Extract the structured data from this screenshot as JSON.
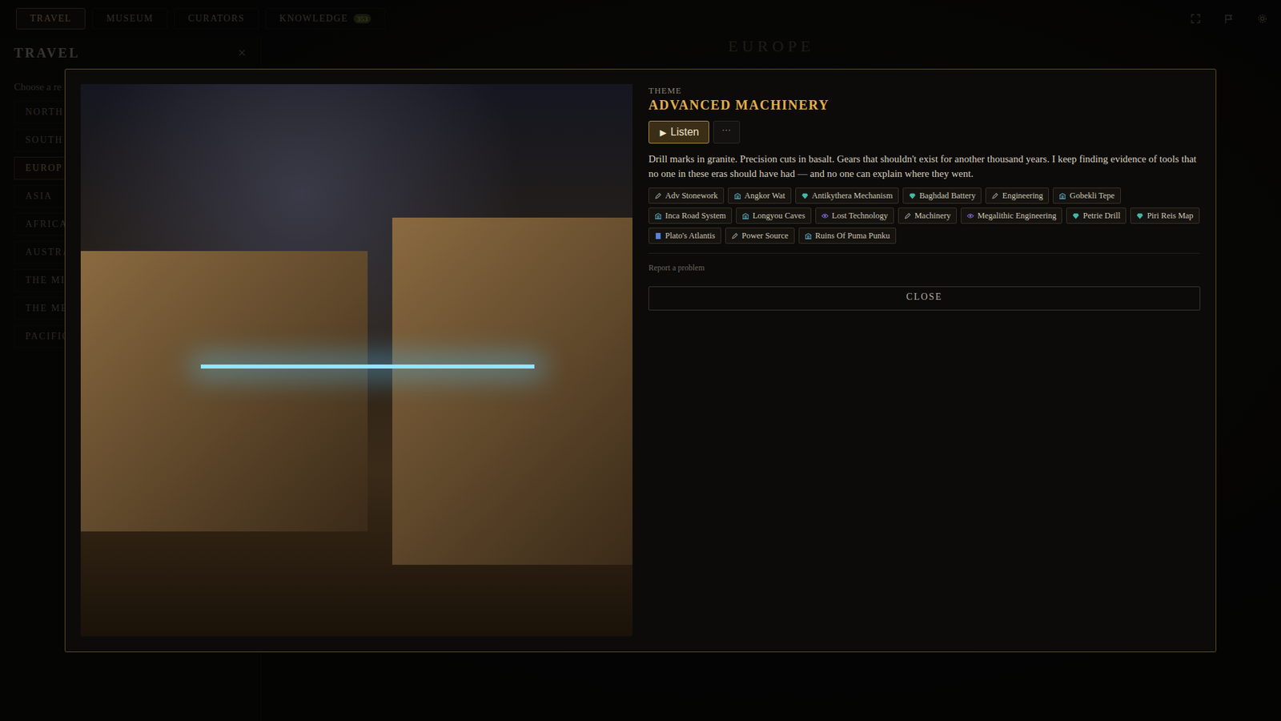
{
  "nav": {
    "tabs": [
      {
        "label": "TRAVEL",
        "selected": true,
        "badge": ""
      },
      {
        "label": "MUSEUM",
        "selected": false,
        "badge": ""
      },
      {
        "label": "CURATORS",
        "selected": false,
        "badge": ""
      },
      {
        "label": "KNOWLEDGE",
        "selected": false,
        "badge": "353"
      }
    ]
  },
  "region_title": "EUROPE",
  "sidebar": {
    "title": "TRAVEL",
    "close": "×",
    "prompt": "Choose a re",
    "items": [
      {
        "label": "NORTH",
        "selected": false
      },
      {
        "label": "SOUTH",
        "selected": false
      },
      {
        "label": "EUROP",
        "selected": true
      },
      {
        "label": "ASIA",
        "selected": false
      },
      {
        "label": "AFRICA",
        "selected": false
      },
      {
        "label": "AUSTRA",
        "selected": false
      },
      {
        "label": "THE MI",
        "selected": false
      },
      {
        "label": "THE ME",
        "selected": false
      },
      {
        "label": "PACIFIC",
        "selected": false
      }
    ]
  },
  "modal": {
    "label": "THEME",
    "title": "ADVANCED MACHINERY",
    "listen_icon": "▶",
    "listen": "Listen",
    "more": "···",
    "description": "Drill marks in granite. Precision cuts in basalt. Gears that shouldn't exist for another thousand years. I keep finding evidence of tools that no one in these eras should have had — and no one can explain where they went.",
    "tags": [
      {
        "label": "Adv Stonework",
        "kind": "concept",
        "color": "#9a968e"
      },
      {
        "label": "Angkor Wat",
        "kind": "site",
        "color": "#5aa7bd"
      },
      {
        "label": "Antikythera Mechanism",
        "kind": "artifact",
        "color": "#3fb9a6"
      },
      {
        "label": "Baghdad Battery",
        "kind": "artifact",
        "color": "#3fb9a6"
      },
      {
        "label": "Engineering",
        "kind": "concept",
        "color": "#9a968e"
      },
      {
        "label": "Gobekli Tepe",
        "kind": "site",
        "color": "#5aa7bd"
      },
      {
        "label": "Inca Road System",
        "kind": "site",
        "color": "#5aa7bd"
      },
      {
        "label": "Longyou Caves",
        "kind": "site",
        "color": "#5aa7bd"
      },
      {
        "label": "Lost Technology",
        "kind": "mystery",
        "color": "#8f6fe0"
      },
      {
        "label": "Machinery",
        "kind": "concept",
        "color": "#9a968e"
      },
      {
        "label": "Megalithic Engineering",
        "kind": "mystery",
        "color": "#8f6fe0"
      },
      {
        "label": "Petrie Drill",
        "kind": "artifact",
        "color": "#3fb9a6"
      },
      {
        "label": "Piri Reis Map",
        "kind": "artifact",
        "color": "#3fb9a6"
      },
      {
        "label": "Plato's Atlantis",
        "kind": "text",
        "color": "#5b82db"
      },
      {
        "label": "Power Source",
        "kind": "concept",
        "color": "#9a968e"
      },
      {
        "label": "Ruins Of Puma Punku",
        "kind": "site",
        "color": "#5aa7bd"
      }
    ],
    "report": "Report a problem",
    "close": "CLOSE"
  }
}
